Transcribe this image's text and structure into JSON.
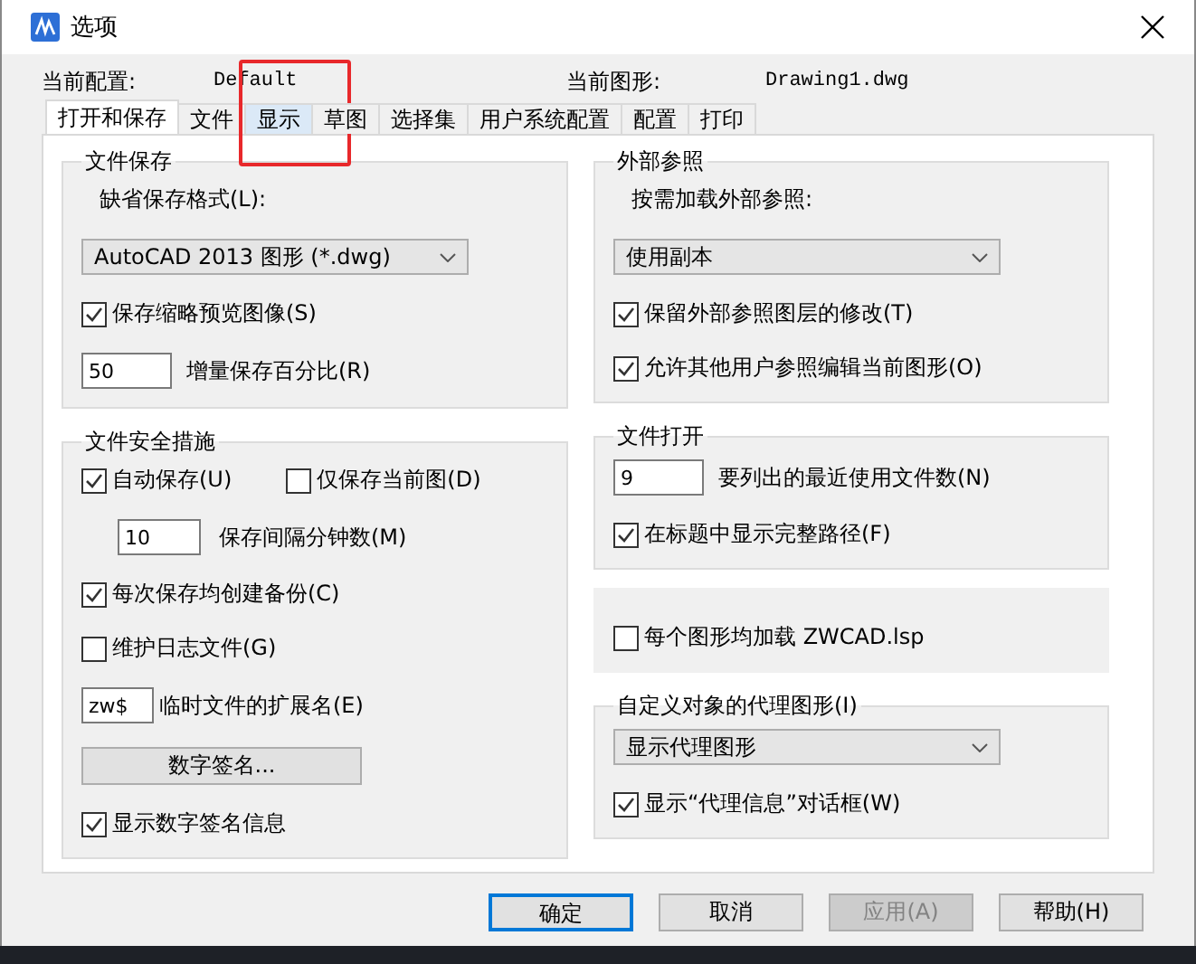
{
  "window": {
    "title": "选项"
  },
  "profile": {
    "current_config_label": "当前配置:",
    "current_config": "Default",
    "current_drawing_label": "当前图形:",
    "current_drawing": "Drawing1.dwg"
  },
  "tabs": [
    {
      "label": "打开和保存",
      "selected": true,
      "highlighted": false
    },
    {
      "label": "文件",
      "selected": false,
      "highlighted": false
    },
    {
      "label": "显示",
      "selected": false,
      "highlighted": true
    },
    {
      "label": "草图",
      "selected": false,
      "highlighted": false
    },
    {
      "label": "选择集",
      "selected": false,
      "highlighted": false
    },
    {
      "label": "用户系统配置",
      "selected": false,
      "highlighted": false
    },
    {
      "label": "配置",
      "selected": false,
      "highlighted": false
    },
    {
      "label": "打印",
      "selected": false,
      "highlighted": false
    }
  ],
  "left_groups": [
    {
      "title": "文件保存",
      "items": [
        {
          "kind": "label",
          "text": "缺省保存格式(L):"
        },
        {
          "kind": "select",
          "value": "AutoCAD 2013 图形 (*.dwg)"
        },
        {
          "kind": "checkbox",
          "label": "保存缩略预览图像(S)",
          "checked": true
        },
        {
          "kind": "number",
          "value": "50",
          "caption": "增量保存百分比(R)"
        }
      ]
    },
    {
      "title": "文件安全措施",
      "items": [
        {
          "kind": "checkbox_row",
          "checkboxes": [
            {
              "label": "自动保存(U)",
              "checked": true
            },
            {
              "label": "仅保存当前图(D)",
              "checked": false
            }
          ]
        },
        {
          "kind": "indented_number",
          "value": "10",
          "caption": "保存间隔分钟数(M)"
        },
        {
          "kind": "checkbox",
          "label": "每次保存均创建备份(C)",
          "checked": true
        },
        {
          "kind": "checkbox",
          "label": "维护日志文件(G)",
          "checked": false
        },
        {
          "kind": "number",
          "value": "zw$",
          "caption": "临时文件的扩展名(E)"
        },
        {
          "kind": "button",
          "label": "数字签名..."
        },
        {
          "kind": "checkbox",
          "label": "显示数字签名信息",
          "checked": true
        }
      ]
    }
  ],
  "right_groups": [
    {
      "title": "外部参照",
      "items": [
        {
          "kind": "label",
          "text": "按需加载外部参照:"
        },
        {
          "kind": "select",
          "value": "使用副本"
        },
        {
          "kind": "checkbox",
          "label": "保留外部参照图层的修改(T)",
          "checked": true
        },
        {
          "kind": "checkbox",
          "label": "允许其他用户参照编辑当前图形(O)",
          "checked": true
        }
      ]
    },
    {
      "title": "文件打开",
      "items": [
        {
          "kind": "number",
          "value": "9",
          "caption": "要列出的最近使用文件数(N)"
        },
        {
          "kind": "checkbox",
          "label": "在标题中显示完整路径(F)",
          "checked": true
        }
      ]
    },
    {
      "items": [
        {
          "kind": "checkbox",
          "label": "每个图形均加载 ZWCAD.lsp",
          "checked": false
        }
      ]
    },
    {
      "title": "自定义对象的代理图形(I)",
      "items": [
        {
          "kind": "select",
          "value": "显示代理图形"
        },
        {
          "kind": "checkbox",
          "label": "显示“代理信息”对话框(W)",
          "checked": true
        }
      ]
    }
  ],
  "buttons": [
    {
      "label": "确定",
      "default": true,
      "disabled": false
    },
    {
      "label": "取消",
      "default": false,
      "disabled": false
    },
    {
      "label": "应用(A)",
      "default": false,
      "disabled": true
    },
    {
      "label": "帮助(H)",
      "default": false,
      "disabled": false
    }
  ]
}
